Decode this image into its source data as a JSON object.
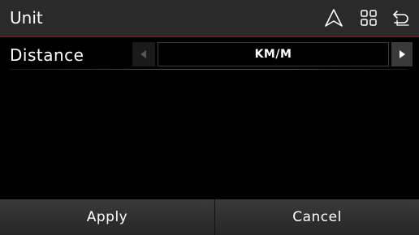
{
  "header": {
    "title": "Unit",
    "icons": [
      "navigation-icon",
      "grid-menu-icon",
      "back-icon"
    ],
    "accent_color": "#8a1622"
  },
  "setting": {
    "label": "Distance",
    "value": "KM/M"
  },
  "footer": {
    "apply_label": "Apply",
    "cancel_label": "Cancel"
  }
}
